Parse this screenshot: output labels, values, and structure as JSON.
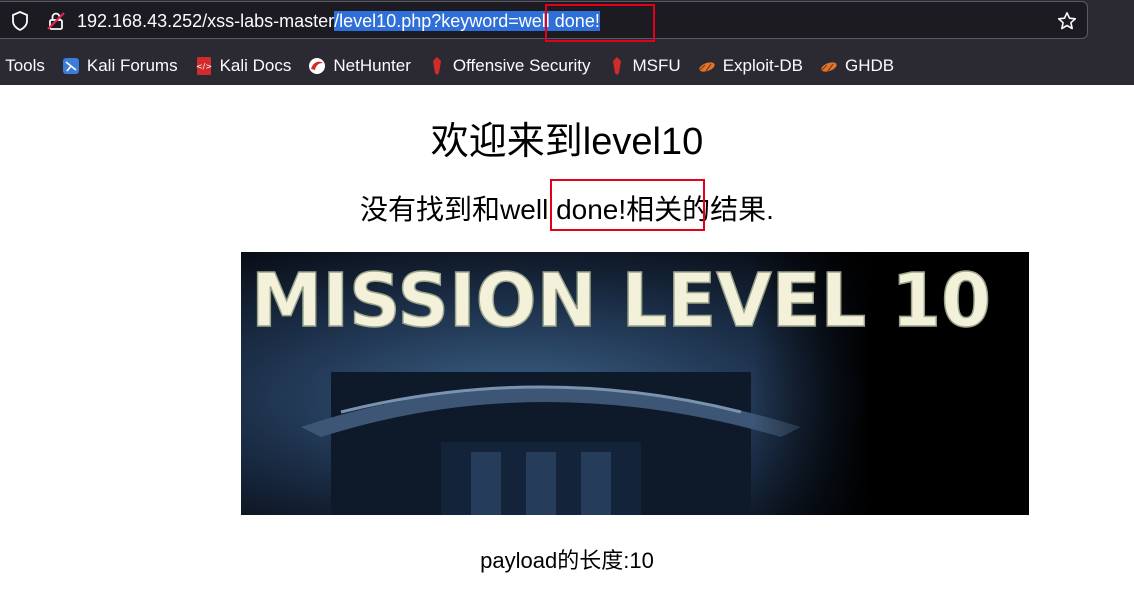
{
  "browser": {
    "url_plain": "192.168.43.252/xss-labs-master",
    "url_selected": "/level10.php?keyword=well done!",
    "bookmarks": [
      {
        "label": "i Tools",
        "icon": "none"
      },
      {
        "label": "Kali Forums",
        "icon": "kali-forums-icon"
      },
      {
        "label": "Kali Docs",
        "icon": "kali-docs-icon"
      },
      {
        "label": "NetHunter",
        "icon": "nethunter-icon"
      },
      {
        "label": "Offensive Security",
        "icon": "offsec-icon"
      },
      {
        "label": "MSFU",
        "icon": "msfu-icon"
      },
      {
        "label": "Exploit-DB",
        "icon": "exploit-db-icon"
      },
      {
        "label": "GHDB",
        "icon": "ghdb-icon"
      }
    ]
  },
  "page": {
    "title": "欢迎来到level10",
    "result_prefix": "没有找到和",
    "keyword": "well done!",
    "result_suffix": "相关的结果.",
    "banner_text": "MISSION LEVEL 10",
    "payload_label": "payload的长度:10"
  },
  "colors": {
    "highlight_box": "#e3001b",
    "url_selection": "#2f6fd8"
  }
}
